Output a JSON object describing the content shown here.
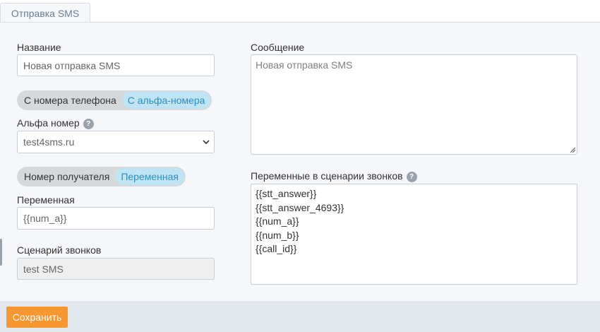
{
  "tab": {
    "label": "Отправка SMS"
  },
  "name_field": {
    "label": "Название",
    "value": "Новая отправка SMS"
  },
  "sender_toggle": {
    "option_phone": "С номера телефона",
    "option_alpha": "С альфа-номера",
    "selected": "С альфа-номера"
  },
  "alpha_number": {
    "label": "Альфа номер",
    "help": "?",
    "selected": "test4sms.ru"
  },
  "recipient_toggle": {
    "option_number": "Номер получателя",
    "option_variable": "Переменная",
    "selected": "Переменная"
  },
  "variable_field": {
    "label": "Переменная",
    "value": "{{num_a}}"
  },
  "scenario_field": {
    "label": "Сценарий звонков",
    "value": "test SMS"
  },
  "message_field": {
    "label": "Сообщение",
    "value": "Новая отправка SMS"
  },
  "scenario_variables": {
    "label": "Переменные в сценарии звонков",
    "help": "?",
    "items": [
      "{{stt_answer}}",
      "{{stt_answer_4693}}",
      "{{num_a}}",
      "{{num_b}}",
      "{{call_id}}"
    ]
  },
  "footer": {
    "save_label": "Сохранить"
  },
  "colors": {
    "accent": "#f8962f",
    "toggle_active_bg": "#bfe5f5",
    "toggle_active_text": "#2a8fc0",
    "panel_bg": "#f5f7fa",
    "footer_bg": "#e4e9f0"
  }
}
